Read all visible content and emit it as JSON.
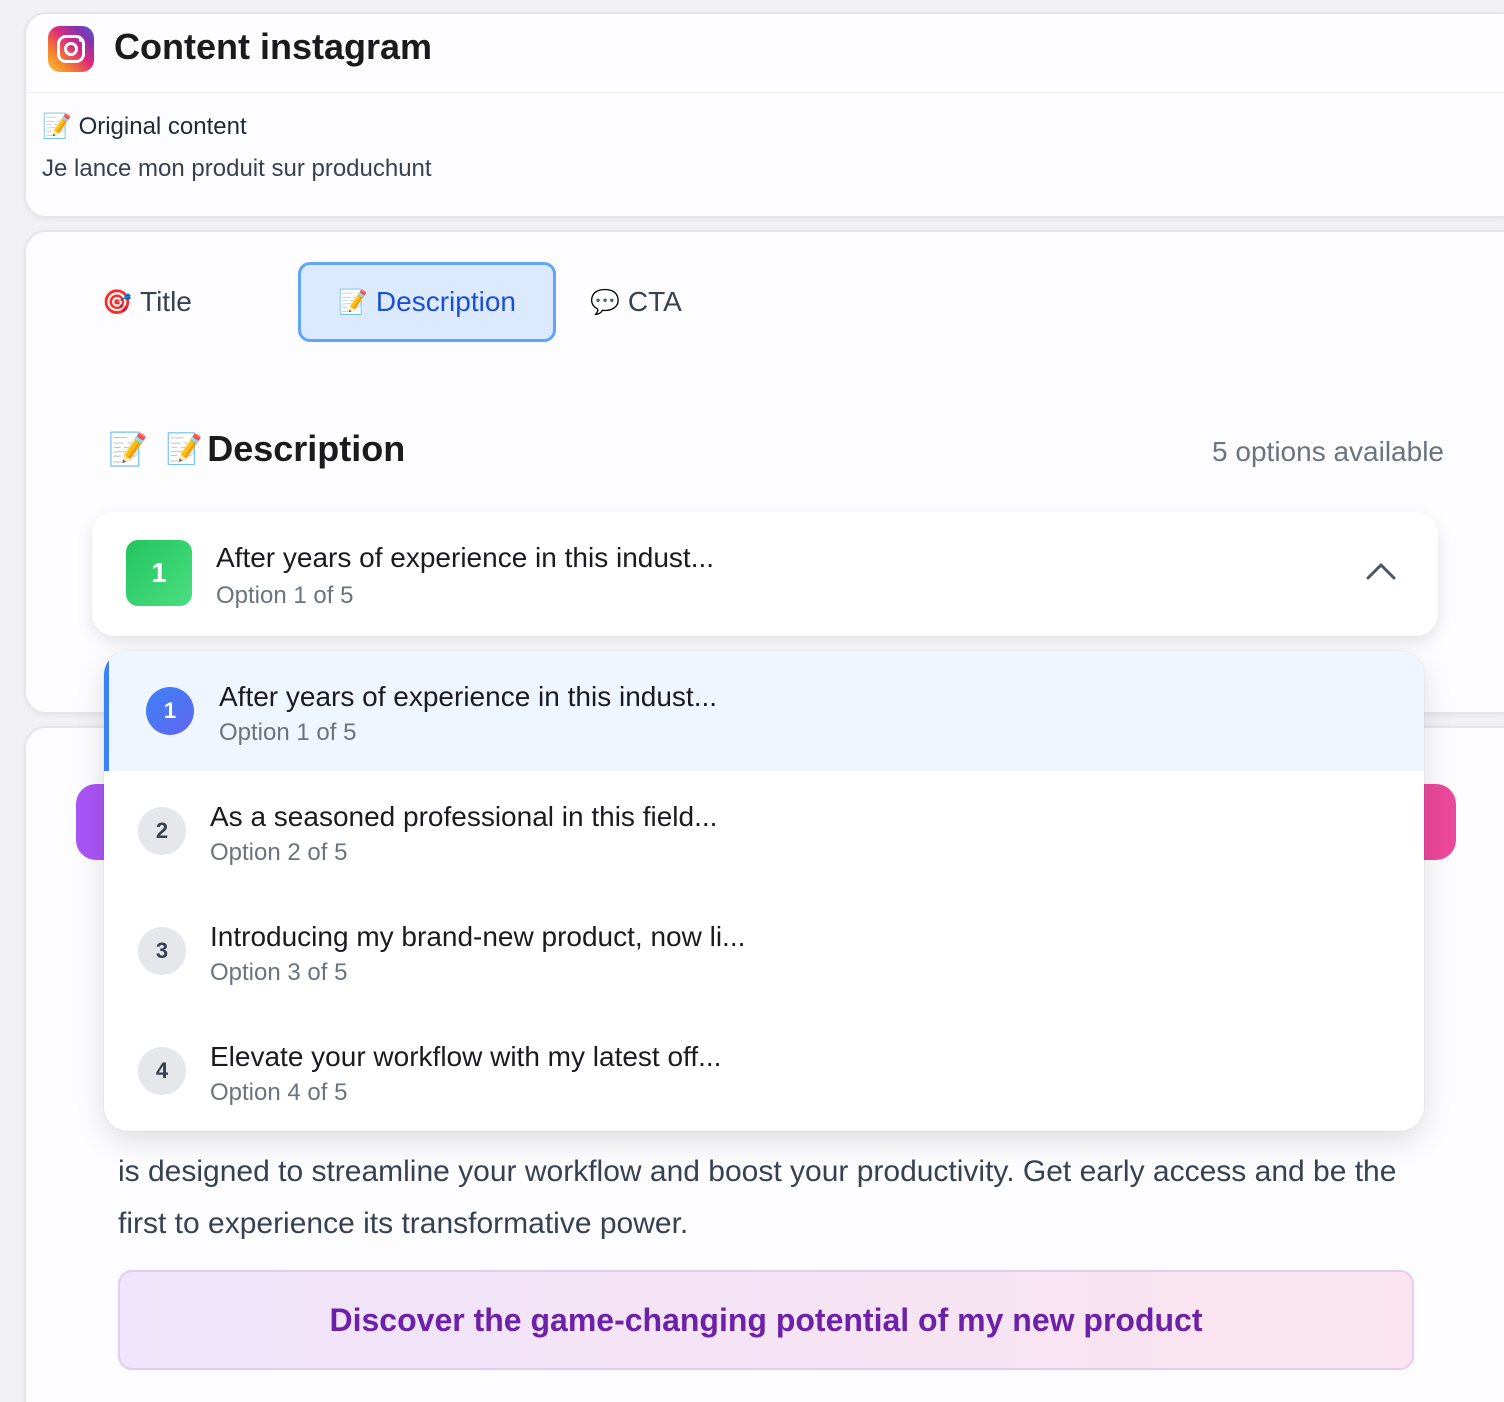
{
  "header": {
    "title": "Content instagram",
    "original_label": "Original content",
    "original_text": "Je lance mon produit sur produchunt"
  },
  "tabs": [
    {
      "emoji": "🎯",
      "label": "Title",
      "active": false
    },
    {
      "emoji": "📝",
      "label": "Description",
      "active": true
    },
    {
      "emoji": "💬",
      "label": "CTA",
      "active": false
    }
  ],
  "section": {
    "emoji": "📝",
    "title_emoji": "📝",
    "title": "Description",
    "options_count": "5 options available"
  },
  "select": {
    "number": "1",
    "text": "After years of experience in this indust...",
    "sub": "Option 1 of 5"
  },
  "dropdown": {
    "items": [
      {
        "number": "1",
        "text": "After years of experience in this indust...",
        "sub": "Option 1 of 5"
      },
      {
        "number": "2",
        "text": "As a seasoned professional in this field...",
        "sub": "Option 2 of 5"
      },
      {
        "number": "3",
        "text": "Introducing my brand-new product, now li...",
        "sub": "Option 3 of 5"
      },
      {
        "number": "4",
        "text": "Elevate your workflow with my latest off...",
        "sub": "Option 4 of 5"
      }
    ]
  },
  "preview": {
    "body": "is designed to streamline your workflow and boost your productivity. Get early access and be the first to experience its transformative power.",
    "cta": "Discover the game-changing potential of my new product"
  },
  "colors": {
    "accent_blue": "#3b82f6",
    "badge_green": "#22c55e",
    "cta_purple": "#6b21a8"
  }
}
